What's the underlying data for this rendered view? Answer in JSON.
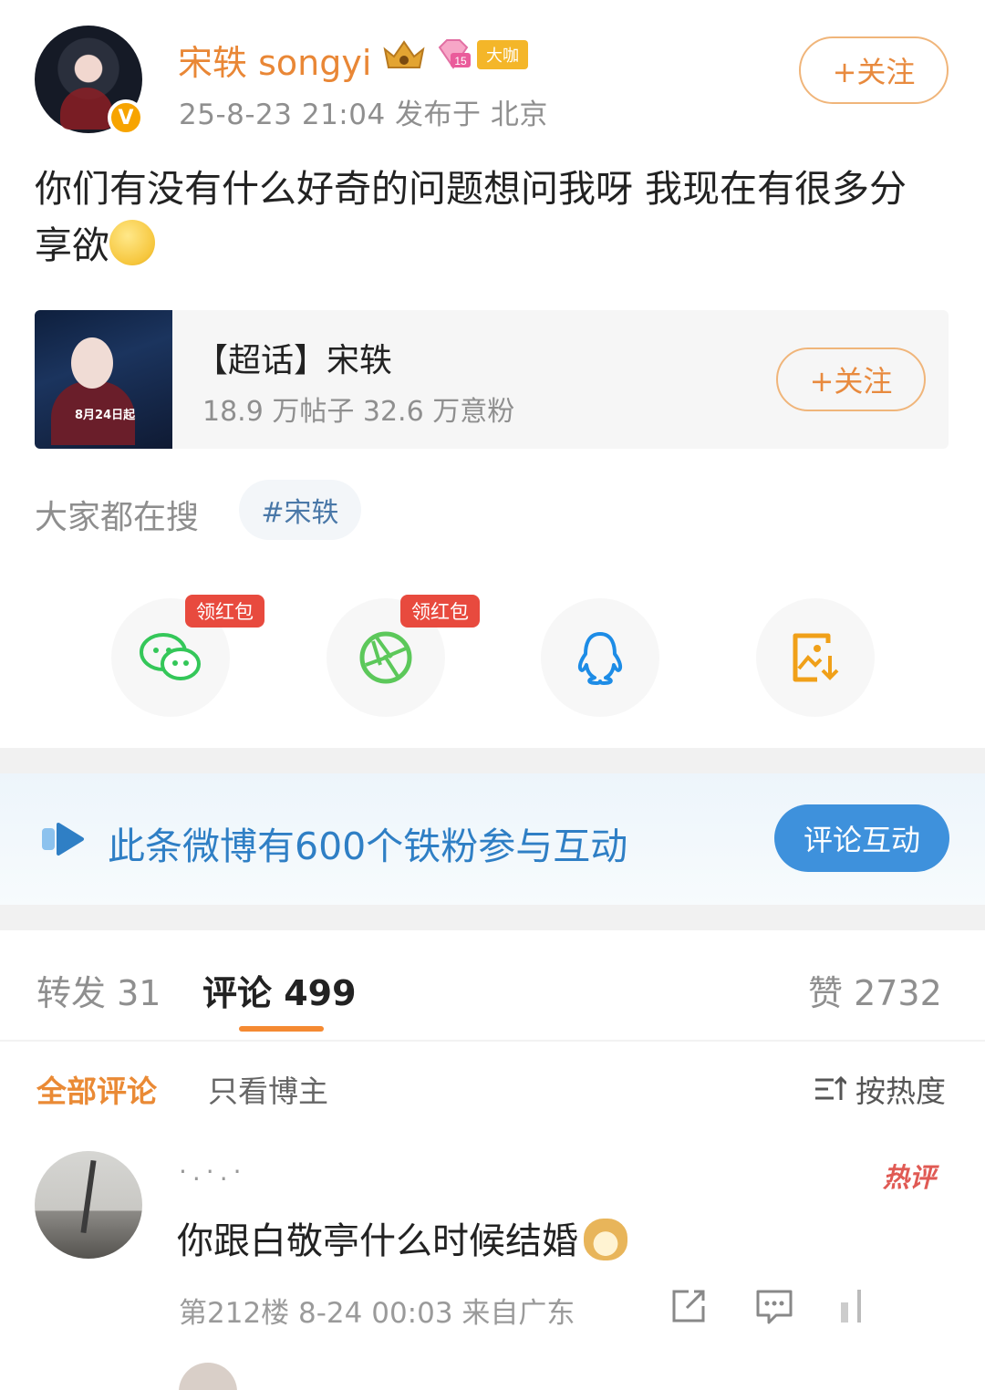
{
  "post": {
    "author": "宋轶 songyi",
    "badge_label": "大咖",
    "vip_level": "15",
    "meta": "25-8-23 21:04  发布于 北京",
    "follow_label": "+关注",
    "content": "你们有没有什么好奇的问题想问我呀 我现在有很多分享欲"
  },
  "topic": {
    "title": "【超话】宋轶",
    "stats": "18.9 万帖子  32.6 万意粉",
    "follow_label": "+关注",
    "poster_date": "8月24日起"
  },
  "search": {
    "label": "大家都在搜",
    "tag": "#宋轶"
  },
  "share": {
    "red_packet_label": "领红包",
    "items": [
      "wechat-icon",
      "moments-icon",
      "qq-icon",
      "save-image-icon"
    ]
  },
  "fan_banner": {
    "text": "此条微博有600个铁粉参与互动",
    "button": "评论互动"
  },
  "stats": {
    "repost": "转发 31",
    "comment": "评论 499",
    "like": "赞 2732"
  },
  "filters": {
    "all": "全部评论",
    "poster_only": "只看博主",
    "sort": "按热度"
  },
  "comment": {
    "user": "·.·.·",
    "hot_label": "热评",
    "text": "你跟白敬亭什么时候结婚",
    "meta": "第212楼 8-24 00:03 来自广东"
  },
  "colors": {
    "accent_orange": "#e98736",
    "link_blue": "#2f7fc5",
    "button_blue": "#3e91dc",
    "red_packet": "#e84a3e"
  }
}
